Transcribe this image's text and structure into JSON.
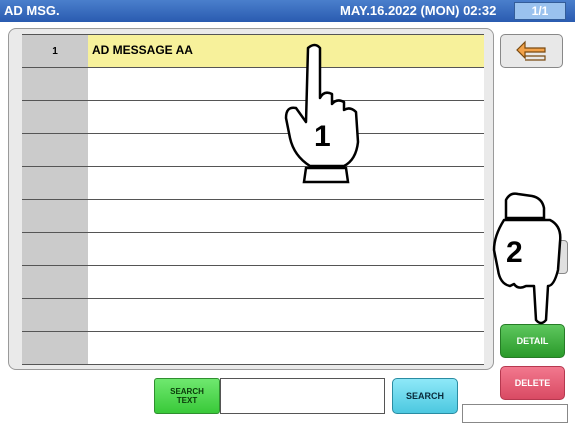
{
  "titlebar": {
    "app_title": "AD MSG.",
    "datetime": "MAY.16.2022 (MON) 02:32",
    "page_indicator": "1/1"
  },
  "messages": [
    {
      "number": "1",
      "text": "AD MESSAGE AA"
    },
    {
      "number": "",
      "text": ""
    },
    {
      "number": "",
      "text": ""
    },
    {
      "number": "",
      "text": ""
    },
    {
      "number": "",
      "text": ""
    },
    {
      "number": "",
      "text": ""
    },
    {
      "number": "",
      "text": ""
    },
    {
      "number": "",
      "text": ""
    },
    {
      "number": "",
      "text": ""
    },
    {
      "number": "",
      "text": ""
    }
  ],
  "buttons": {
    "back_icon": "back-arrow-icon",
    "detail": "DETAIL",
    "delete": "DELETE",
    "search_text": "SEARCH\nTEXT",
    "search": "SEARCH"
  },
  "search": {
    "value": ""
  },
  "callouts": {
    "step1": "1",
    "step2": "2"
  },
  "colors": {
    "selected_row": "#f7f19b",
    "detail": "#3fb13f",
    "delete": "#e0607a",
    "search": "#6cd6ec",
    "search_text": "#55dd55"
  }
}
